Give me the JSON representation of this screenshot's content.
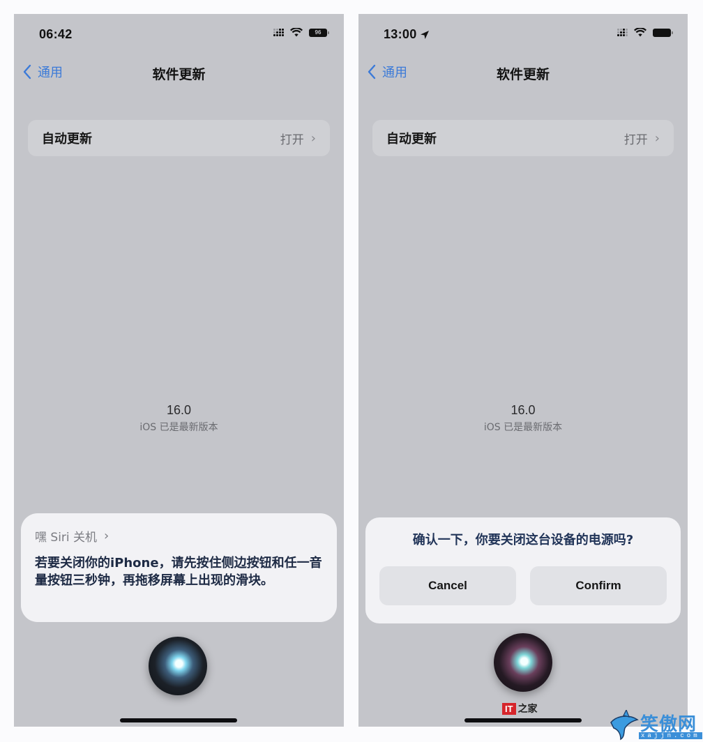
{
  "left_screen": {
    "status": {
      "time": "06:42",
      "battery": "96"
    },
    "nav": {
      "back_label": "通用",
      "title": "软件更新"
    },
    "auto_update": {
      "label": "自动更新",
      "value": "打开"
    },
    "version": {
      "number": "16.0",
      "status": "iOS 已是最新版本"
    },
    "siri": {
      "source_label": "嘿 Siri 关机",
      "message": "若要关闭你的iPhone，请先按住侧边按钮和任一音量按钮三秒钟，再拖移屏幕上出现的滑块。"
    }
  },
  "right_screen": {
    "status": {
      "time": "13:00"
    },
    "nav": {
      "back_label": "通用",
      "title": "软件更新"
    },
    "auto_update": {
      "label": "自动更新",
      "value": "打开"
    },
    "version": {
      "number": "16.0",
      "status": "iOS 已是最新版本"
    },
    "dialog": {
      "question": "确认一下，你要关闭这台设备的电源吗?",
      "cancel_label": "Cancel",
      "confirm_label": "Confirm"
    },
    "source_logo": {
      "box": "IT",
      "text": "之家"
    }
  },
  "watermark": {
    "name": "笑傲网",
    "url": "xajjn.com"
  },
  "icons": {
    "signal": "signal-bars-icon",
    "wifi": "wifi-icon",
    "battery": "battery-icon",
    "location": "location-arrow-icon",
    "back": "chevron-left-icon",
    "row_chevron": "chevron-right-icon",
    "siri": "siri-orb-icon"
  },
  "colors": {
    "accent": "#3b7ad8",
    "background": "#c4c5ca",
    "card": "#f2f2f5"
  }
}
